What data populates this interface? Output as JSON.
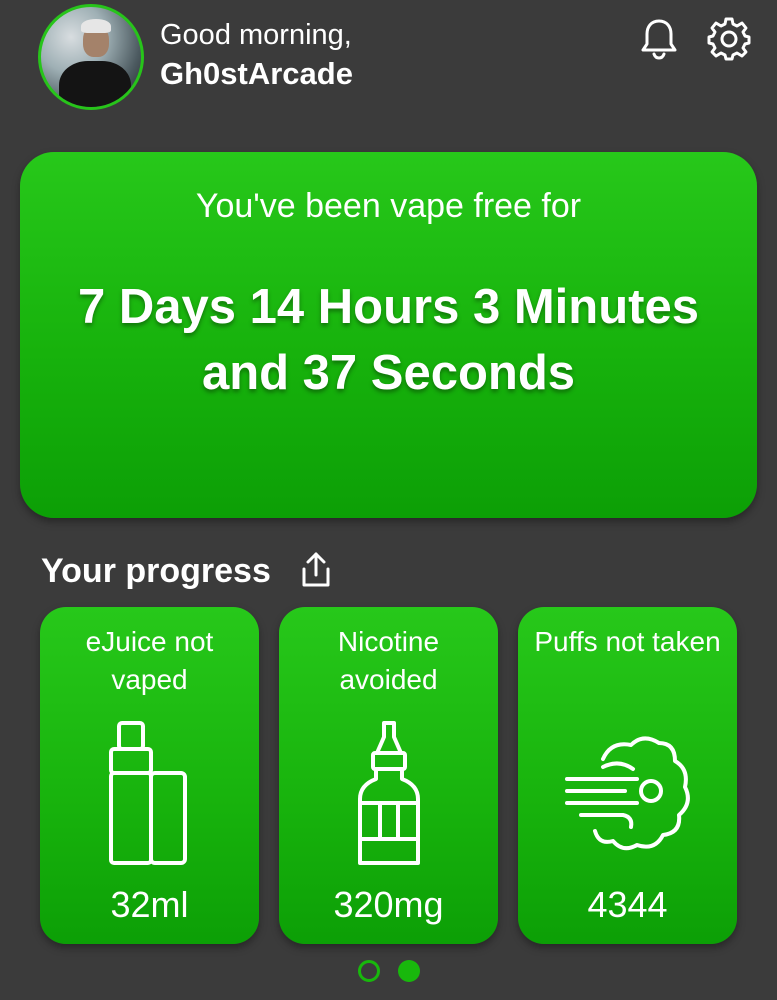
{
  "header": {
    "greeting": "Good morning,",
    "username": "Gh0stArcade",
    "avatar_icon": "profile-photo",
    "notifications_icon": "bell-icon",
    "settings_icon": "gear-icon"
  },
  "hero": {
    "subtitle": "You've been vape free for",
    "duration": "7 Days 14 Hours 3 Minutes and 37 Seconds"
  },
  "progress": {
    "heading": "Your progress",
    "share_icon": "share-icon",
    "cards": [
      {
        "label": "eJuice not vaped",
        "value": "32ml",
        "icon": "vape-mod-icon"
      },
      {
        "label": "Nicotine avoided",
        "value": "320mg",
        "icon": "dropper-bottle-icon"
      },
      {
        "label": "Puffs not taken",
        "value": "4344",
        "icon": "smoke-cloud-icon"
      }
    ]
  },
  "pager": {
    "pages": 2,
    "active_index": 1
  },
  "colors": {
    "background": "#3b3b3b",
    "accent_green": "#1bb810",
    "text": "#ffffff"
  }
}
